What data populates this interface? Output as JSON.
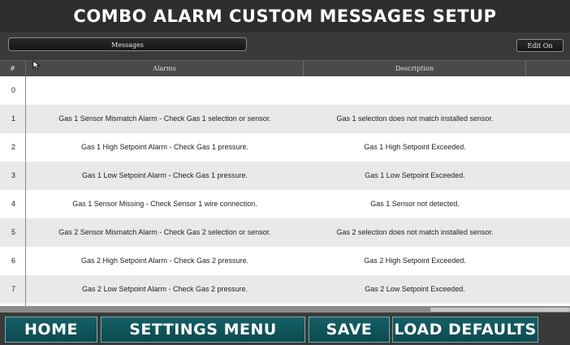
{
  "title": "COMBO ALARM CUSTOM MESSAGES SETUP",
  "toolbar": {
    "messages_label": "Messages",
    "edit_label": "Edit On"
  },
  "table": {
    "columns": {
      "num": "#",
      "alarms": "Alarms",
      "description": "Description"
    },
    "rows": [
      {
        "num": "0",
        "alarm": "",
        "description": ""
      },
      {
        "num": "1",
        "alarm": "Gas 1 Sensor Mismatch Alarm - Check Gas 1 selection or sensor.",
        "description": "Gas 1 selection does not match installed sensor."
      },
      {
        "num": "2",
        "alarm": "Gas 1 High Setpoint Alarm - Check Gas 1 pressure.",
        "description": "Gas 1 High Setpoint Exceeded."
      },
      {
        "num": "3",
        "alarm": "Gas 1 Low Setpoint Alarm - Check Gas 1 pressure.",
        "description": "Gas 1 Low Setpoint Exceeded."
      },
      {
        "num": "4",
        "alarm": "Gas 1 Sensor Missing - Check Sensor 1 wire connection.",
        "description": "Gas 1 Sensor not detected."
      },
      {
        "num": "5",
        "alarm": "Gas 2 Sensor Mismatch Alarm - Check Gas 2 selection or sensor.",
        "description": "Gas 2 selection does not match installed sensor."
      },
      {
        "num": "6",
        "alarm": "Gas 2 High Setpoint Alarm - Check Gas 2 pressure.",
        "description": "Gas 2 High Setpoint Exceeded."
      },
      {
        "num": "7",
        "alarm": "Gas 2 Low Setpoint Alarm - Check Gas 2 pressure.",
        "description": "Gas 2 Low Setpoint Exceeded."
      }
    ]
  },
  "footer": {
    "home_label": "HOME",
    "settings_label": "SETTINGS MENU",
    "save_label": "SAVE",
    "load_defaults_label": "LOAD DEFAULTS"
  },
  "colors": {
    "footer_button": "#0f5a60",
    "background": "#3a3a3a",
    "row_alt": "#ebe9e7"
  }
}
